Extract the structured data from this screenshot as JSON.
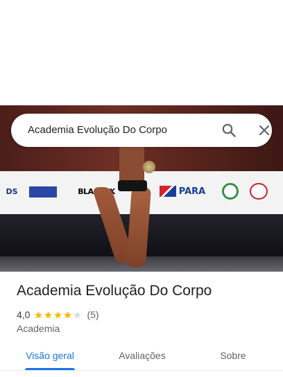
{
  "search": {
    "query": "Academia Evolução Do Corpo"
  },
  "photo": {
    "sponsor_logos": [
      "DS",
      "BLACKSK",
      "PARA"
    ]
  },
  "place": {
    "title": "Academia Evolução Do Corpo",
    "rating": "4,0",
    "stars_filled": 4,
    "stars_total": 5,
    "review_count": "(5)",
    "category": "Academia"
  },
  "tabs": [
    {
      "label": "Visão geral",
      "active": true
    },
    {
      "label": "Avaliações",
      "active": false
    },
    {
      "label": "Sobre",
      "active": false
    }
  ],
  "colors": {
    "accent": "#1a73e8",
    "star": "#fbbc04",
    "star_empty": "#dadce0"
  },
  "icons": [
    "search-icon",
    "close-icon",
    "star-icon"
  ]
}
